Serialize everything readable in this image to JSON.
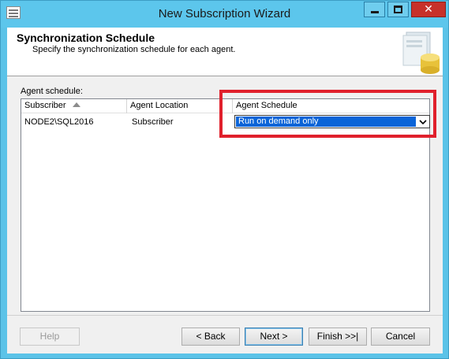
{
  "window": {
    "title": "New Subscription Wizard",
    "accent_color": "#5cc6ec",
    "close_color": "#c7312a",
    "icons": [
      "app-icon",
      "minimize-icon",
      "maximize-icon",
      "close-icon"
    ]
  },
  "header": {
    "title": "Synchronization Schedule",
    "subtitle": "Specify the synchronization schedule for each agent."
  },
  "agent_schedule": {
    "label": "Agent schedule:",
    "columns": [
      "Subscriber",
      "Agent Location",
      "Agent Schedule"
    ],
    "sort_column": "Subscriber",
    "rows": [
      {
        "subscriber": "NODE2\\SQL2016",
        "location": "Subscriber",
        "schedule": "Run on demand only"
      }
    ],
    "selection_color": "#0a64d8",
    "highlight_color": "#e0202c"
  },
  "footer": {
    "help": "Help",
    "back": "< Back",
    "next": "Next >",
    "finish": "Finish >>|",
    "cancel": "Cancel"
  }
}
